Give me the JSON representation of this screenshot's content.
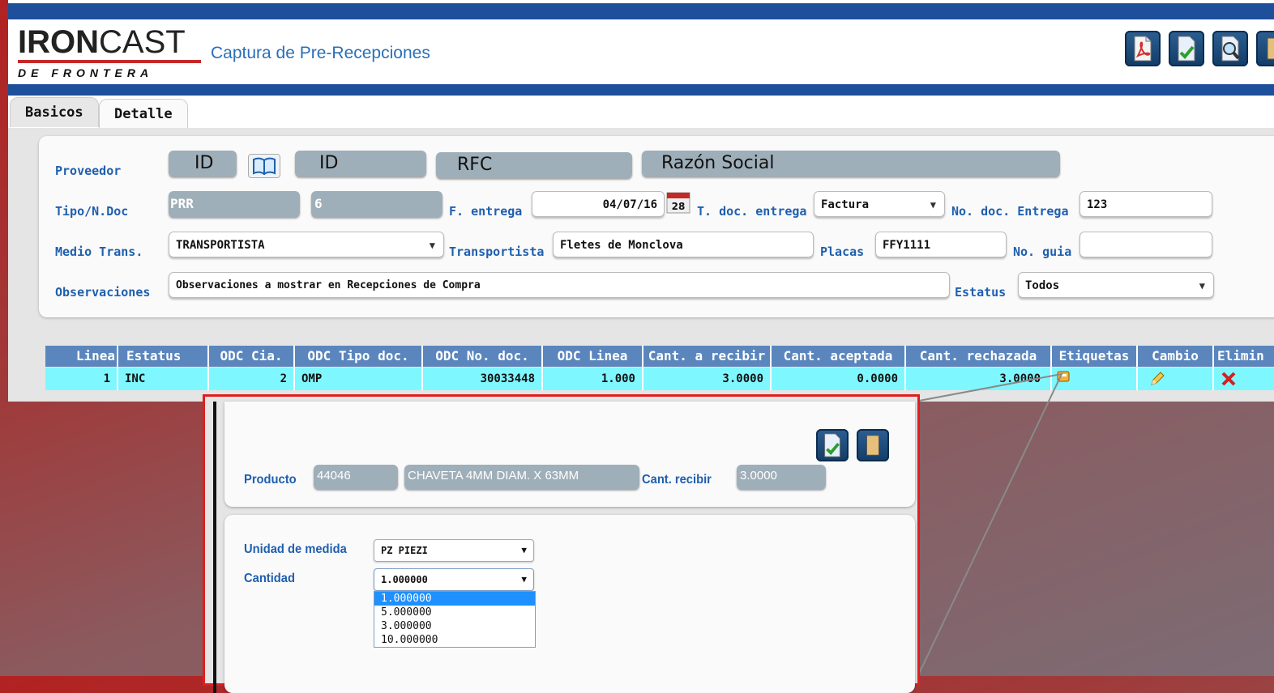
{
  "brand": {
    "name_bold": "IRON",
    "name_light": "CAST",
    "subtitle": "DE FRONTERA"
  },
  "page_title": "Captura de Pre-Recepciones",
  "toolbar": {
    "icons": [
      "pdf-icon",
      "save-check-icon",
      "search-icon",
      "exit-icon"
    ]
  },
  "tabs": [
    {
      "label": "Basicos",
      "active": true
    },
    {
      "label": "Detalle",
      "active": false
    }
  ],
  "form": {
    "proveedor": {
      "label": "Proveedor",
      "id1": "ID",
      "id2": "ID",
      "rfc": "RFC",
      "razon": "Razón Social"
    },
    "tipo": {
      "label": "Tipo/N.Doc",
      "tipo": "PRR",
      "numero": "6"
    },
    "fentrega": {
      "label": "F. entrega",
      "value": "04/07/16",
      "cal_day": "28"
    },
    "tdoc": {
      "label": "T. doc. entrega",
      "value": "Factura"
    },
    "nodoc": {
      "label": "No. doc. Entrega",
      "value": "123"
    },
    "medio": {
      "label": "Medio Trans.",
      "value": "TRANSPORTISTA"
    },
    "transportista": {
      "label": "Transportista",
      "value": "Fletes de Monclova"
    },
    "placas": {
      "label": "Placas",
      "value": "FFY1111"
    },
    "noguia": {
      "label": "No. guia",
      "value": ""
    },
    "observaciones": {
      "label": "Observaciones",
      "value": "Observaciones a mostrar en Recepciones de Compra"
    },
    "estatus": {
      "label": "Estatus",
      "value": "Todos"
    }
  },
  "grid": {
    "headers": [
      "Linea",
      "Estatus",
      "ODC Cia.",
      "ODC Tipo doc.",
      "ODC No. doc.",
      "ODC Linea",
      "Cant. a recibir",
      "Cant. aceptada",
      "Cant. rechazada",
      "Etiquetas",
      "Cambio",
      "Elimin"
    ],
    "row": [
      "1",
      "INC",
      "2",
      "OMP",
      "30033448",
      "1.000",
      "3.0000",
      "0.0000",
      "3.0000"
    ]
  },
  "modal": {
    "producto_label": "Producto",
    "producto_code": "44046",
    "producto_desc": "CHAVETA 4MM DIAM. X 63MM",
    "cant_label": "Cant. recibir",
    "cant_value": "3.0000",
    "unidad_label": "Unidad de medida",
    "unidad_value": "PZ PIEZI",
    "cantidad_label": "Cantidad",
    "cantidad_value": "1.000000",
    "cantidad_options": [
      "1.000000",
      "5.000000",
      "3.000000",
      "10.000000"
    ]
  },
  "colors": {
    "accent": "#1f5fae",
    "header_bar": "#1e4f9a",
    "row_highlight": "#7ff7ff",
    "callout": "#e01e1e"
  }
}
